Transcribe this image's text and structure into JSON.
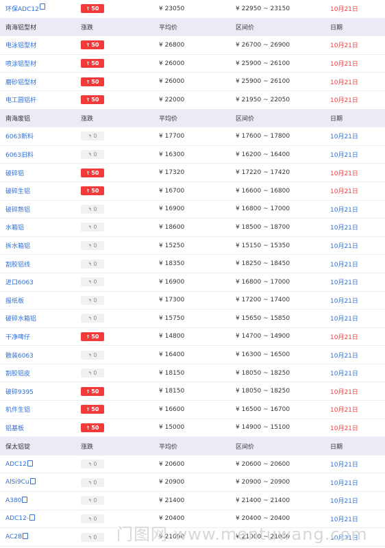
{
  "header_labels": {
    "change": "涨跌",
    "avg": "平均价",
    "range": "区间价",
    "date": "日期"
  },
  "sections": [
    {
      "title": null,
      "rows": [
        {
          "name": "环保ADC12",
          "icon": true,
          "change": "50",
          "dir": "up",
          "avg": "¥ 23050",
          "range": "¥ 22950 ~ 23150",
          "date": "10月21日"
        }
      ]
    },
    {
      "title": "南海铝型材",
      "rows": [
        {
          "name": "电泳铝型材",
          "change": "50",
          "dir": "up",
          "avg": "¥ 26800",
          "range": "¥ 26700 ~ 26900",
          "date": "10月21日"
        },
        {
          "name": "喷涂铝型材",
          "change": "50",
          "dir": "up",
          "avg": "¥ 26000",
          "range": "¥ 25900 ~ 26100",
          "date": "10月21日"
        },
        {
          "name": "磨砂铝型材",
          "change": "50",
          "dir": "up",
          "avg": "¥ 26000",
          "range": "¥ 25900 ~ 26100",
          "date": "10月21日"
        },
        {
          "name": "电工圆铝杆",
          "change": "50",
          "dir": "up",
          "avg": "¥ 22000",
          "range": "¥ 21950 ~ 22050",
          "date": "10月21日"
        }
      ]
    },
    {
      "title": "南海废铝",
      "rows": [
        {
          "name": "6063新料",
          "change": "0",
          "dir": "flat",
          "avg": "¥ 17700",
          "range": "¥ 17600 ~ 17800",
          "date": "10月21日"
        },
        {
          "name": "6063旧料",
          "change": "0",
          "dir": "flat",
          "avg": "¥ 16300",
          "range": "¥ 16200 ~ 16400",
          "date": "10月21日"
        },
        {
          "name": "破碎铝",
          "change": "50",
          "dir": "up",
          "avg": "¥ 17320",
          "range": "¥ 17220 ~ 17420",
          "date": "10月21日"
        },
        {
          "name": "破碎生铝",
          "change": "50",
          "dir": "up",
          "avg": "¥ 16700",
          "range": "¥ 16600 ~ 16800",
          "date": "10月21日"
        },
        {
          "name": "破碎熟铝",
          "change": "0",
          "dir": "flat",
          "avg": "¥ 16900",
          "range": "¥ 16800 ~ 17000",
          "date": "10月21日"
        },
        {
          "name": "水箱铝",
          "change": "0",
          "dir": "flat",
          "avg": "¥ 18600",
          "range": "¥ 18500 ~ 18700",
          "date": "10月21日"
        },
        {
          "name": "拆水箱铝",
          "change": "0",
          "dir": "flat",
          "avg": "¥ 15250",
          "range": "¥ 15150 ~ 15350",
          "date": "10月21日"
        },
        {
          "name": "割胶铝线",
          "change": "0",
          "dir": "flat",
          "avg": "¥ 18350",
          "range": "¥ 18250 ~ 18450",
          "date": "10月21日"
        },
        {
          "name": "进口6063",
          "change": "0",
          "dir": "flat",
          "avg": "¥ 16900",
          "range": "¥ 16800 ~ 17000",
          "date": "10月21日"
        },
        {
          "name": "报纸板",
          "change": "0",
          "dir": "flat",
          "avg": "¥ 17300",
          "range": "¥ 17200 ~ 17400",
          "date": "10月21日"
        },
        {
          "name": "破碎水箱铝",
          "change": "0",
          "dir": "flat",
          "avg": "¥ 15750",
          "range": "¥ 15650 ~ 15850",
          "date": "10月21日"
        },
        {
          "name": "干净啤仔",
          "change": "50",
          "dir": "up",
          "avg": "¥ 14800",
          "range": "¥ 14700 ~ 14900",
          "date": "10月21日"
        },
        {
          "name": "散装6063",
          "change": "0",
          "dir": "flat",
          "avg": "¥ 16400",
          "range": "¥ 16300 ~ 16500",
          "date": "10月21日"
        },
        {
          "name": "割胶铝皮",
          "change": "0",
          "dir": "flat",
          "avg": "¥ 18150",
          "range": "¥ 18050 ~ 18250",
          "date": "10月21日"
        },
        {
          "name": "破碎9395",
          "change": "50",
          "dir": "up",
          "avg": "¥ 18150",
          "range": "¥ 18050 ~ 18250",
          "date": "10月21日"
        },
        {
          "name": "机件生铝",
          "change": "50",
          "dir": "up",
          "avg": "¥ 16600",
          "range": "¥ 16500 ~ 16700",
          "date": "10月21日"
        },
        {
          "name": "铝基板",
          "change": "50",
          "dir": "up",
          "avg": "¥ 15000",
          "range": "¥ 14900 ~ 15100",
          "date": "10月21日"
        }
      ]
    },
    {
      "title": "保太铝锭",
      "rows": [
        {
          "name": "ADC12",
          "icon": true,
          "change": "0",
          "dir": "flat",
          "avg": "¥ 20600",
          "range": "¥ 20600 ~ 20600",
          "date": "10月21日"
        },
        {
          "name": "AlSi9Cu",
          "icon": true,
          "change": "0",
          "dir": "flat",
          "avg": "¥ 20900",
          "range": "¥ 20900 ~ 20900",
          "date": "10月21日"
        },
        {
          "name": "A380",
          "icon": true,
          "change": "0",
          "dir": "flat",
          "avg": "¥ 21400",
          "range": "¥ 21400 ~ 21400",
          "date": "10月21日"
        },
        {
          "name": "ADC12-",
          "icon": true,
          "change": "0",
          "dir": "flat",
          "avg": "¥ 20400",
          "range": "¥ 20400 ~ 20400",
          "date": "10月21日"
        },
        {
          "name": "AC2B",
          "icon": true,
          "change": "0",
          "dir": "flat",
          "avg": "¥ 21000",
          "range": "¥ 21000 ~ 21000",
          "date": "10月21日"
        }
      ]
    }
  ],
  "watermark": "门图网 www.mentuwang.com",
  "colors": {
    "up": "#f23a3a",
    "flat_bg": "#f1f1f4",
    "link": "#2f6fd6",
    "header_bg": "#edeaf7"
  }
}
